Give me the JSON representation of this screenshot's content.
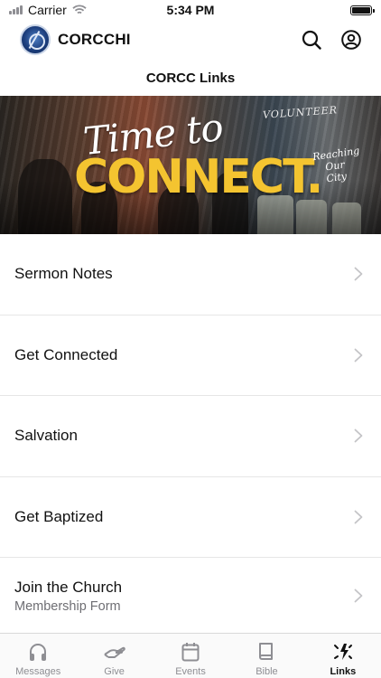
{
  "status_bar": {
    "carrier": "Carrier",
    "time": "5:34 PM"
  },
  "header": {
    "app_name": "CORCCHI",
    "logo_icon": "church-logo-icon",
    "search_icon": "search-icon",
    "profile_icon": "user-profile-icon"
  },
  "page": {
    "title": "CORCC Links"
  },
  "banner": {
    "script_line": "Time to",
    "headline": "CONNECT.",
    "volume_text": "VOLUNTEER",
    "side_text": "Reaching Our City"
  },
  "links": [
    {
      "label": "Sermon Notes",
      "sublabel": ""
    },
    {
      "label": "Get Connected",
      "sublabel": ""
    },
    {
      "label": "Salvation",
      "sublabel": ""
    },
    {
      "label": "Get Baptized",
      "sublabel": ""
    },
    {
      "label": "Join the Church",
      "sublabel": "Membership Form"
    }
  ],
  "tabs": [
    {
      "label": "Messages",
      "icon": "headphones-icon",
      "active": false
    },
    {
      "label": "Give",
      "icon": "give-hand-icon",
      "active": false
    },
    {
      "label": "Events",
      "icon": "calendar-icon",
      "active": false
    },
    {
      "label": "Bible",
      "icon": "bible-book-icon",
      "active": false
    },
    {
      "label": "Links",
      "icon": "links-burst-icon",
      "active": true
    }
  ],
  "colors": {
    "accent_yellow": "#f4c430",
    "text_primary": "#111111",
    "text_secondary": "#6e6e73",
    "tab_inactive": "#8e8e93",
    "divider": "#e6e6e6"
  }
}
